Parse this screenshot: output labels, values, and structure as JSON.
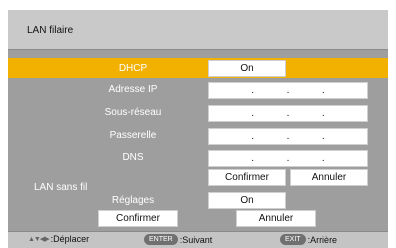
{
  "header": {
    "title": "LAN filaire"
  },
  "wired": {
    "dhcp": {
      "label": "DHCP",
      "value": "On"
    },
    "ip_label": "Adresse IP",
    "subnet_label": "Sous-réseau",
    "gateway_label": "Passerelle",
    "dns_label": "DNS",
    "ip_placeholder": ". . .",
    "confirm_label": "Confirmer",
    "cancel_label": "Annuler"
  },
  "wireless": {
    "section_title": "LAN sans fil",
    "settings_label": "Réglages",
    "settings_value": "On",
    "confirm_label": "Confirmer",
    "cancel_label": "Annuler"
  },
  "footer": {
    "move_label": ":Déplacer",
    "enter_key": "ENTER",
    "next_label": ":Suivant",
    "exit_key": "EXIT",
    "back_label": ":Arrière"
  },
  "colors": {
    "highlight": "#f2b100",
    "panel": "#9e9e9e",
    "header": "#c9c9c9"
  }
}
